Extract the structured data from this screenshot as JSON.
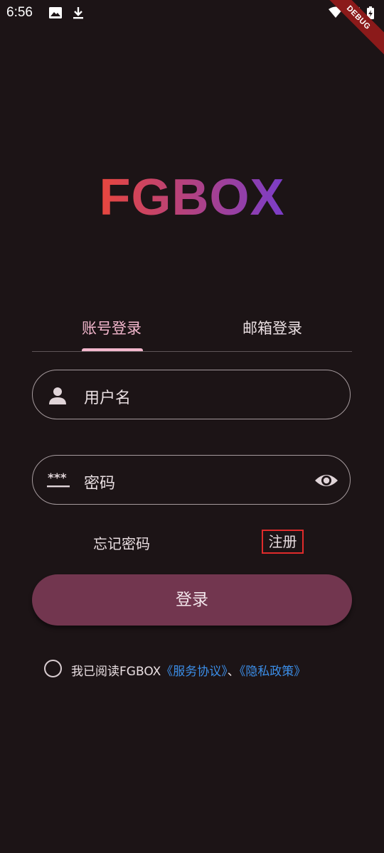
{
  "status_bar": {
    "time": "6:56",
    "debug_label": "DEBUG"
  },
  "logo": {
    "text": "FGBOX"
  },
  "tabs": [
    {
      "label": "账号登录",
      "selected": true
    },
    {
      "label": "邮箱登录",
      "selected": false
    }
  ],
  "username_field": {
    "placeholder": "用户名"
  },
  "password_field": {
    "placeholder": "密码"
  },
  "links": {
    "forgot_password": "忘记密码",
    "register": "注册"
  },
  "login_button": {
    "label": "登录"
  },
  "agreement": {
    "prefix": "我已阅读FGBOX",
    "service_terms": "《服务协议》",
    "separator": "、",
    "privacy_policy": "《隐私政策》"
  },
  "colors": {
    "background": "#1c1416",
    "accent_pink": "#f3b7cd",
    "button": "#72364f",
    "link": "#3b8ee8",
    "logo_gradient_start": "#e8463d",
    "logo_gradient_end": "#7a3dc9"
  }
}
